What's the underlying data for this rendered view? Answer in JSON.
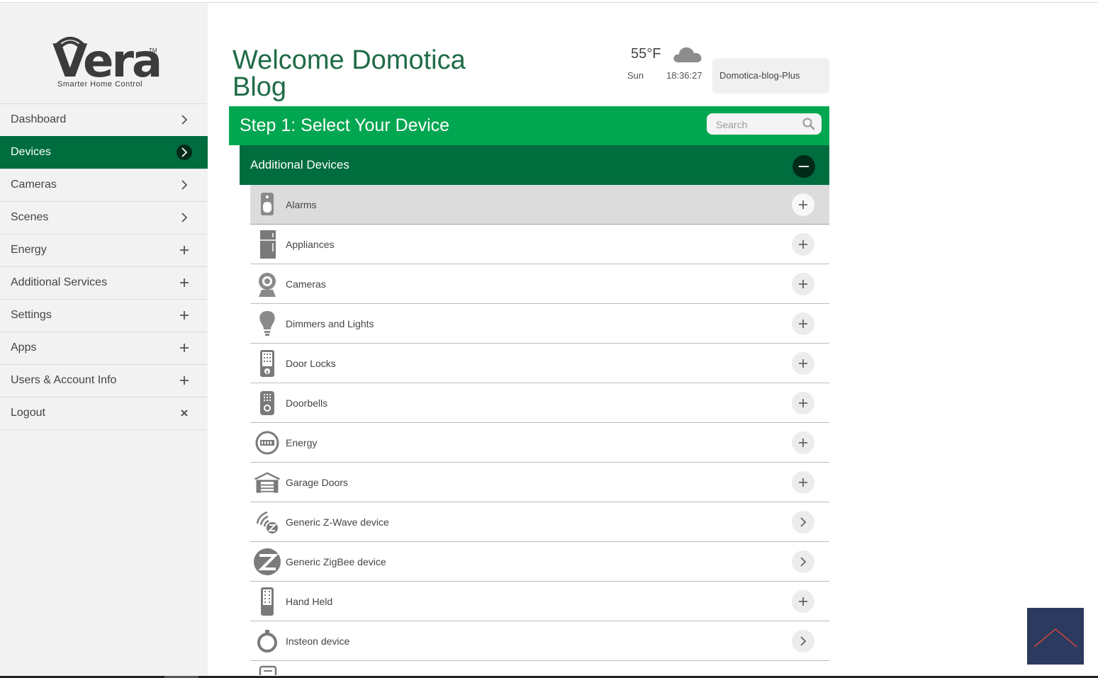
{
  "brand": {
    "logo_text": "Vera",
    "logo_tm": "TM",
    "tagline": "Smarter Home Control"
  },
  "sidebar": {
    "items": [
      {
        "label": "Dashboard",
        "icon": "chevron-right-icon",
        "active": false
      },
      {
        "label": "Devices",
        "icon": "chevron-right-icon",
        "active": true
      },
      {
        "label": "Cameras",
        "icon": "chevron-right-icon",
        "active": false
      },
      {
        "label": "Scenes",
        "icon": "chevron-right-icon",
        "active": false
      },
      {
        "label": "Energy",
        "icon": "plus-icon",
        "active": false
      },
      {
        "label": "Additional Services",
        "icon": "plus-icon",
        "active": false
      },
      {
        "label": "Settings",
        "icon": "plus-icon",
        "active": false
      },
      {
        "label": "Apps",
        "icon": "plus-icon",
        "active": false
      },
      {
        "label": "Users & Account Info",
        "icon": "plus-icon",
        "active": false
      },
      {
        "label": "Logout",
        "icon": "close-icon",
        "active": false
      }
    ]
  },
  "header": {
    "welcome": "Welcome Domotica Blog",
    "weather": {
      "temperature": "55°F",
      "icon": "cloud-icon",
      "day": "Sun",
      "time": "18:36:27"
    },
    "account_name": "Domotica-blog-Plus"
  },
  "step": {
    "title": "Step 1: Select Your Device",
    "search_placeholder": "Search"
  },
  "category": {
    "title": "Additional Devices"
  },
  "devices": [
    {
      "label": "Alarms",
      "icon": "alarm-sensor-icon",
      "action": "plus-icon",
      "highlight": true
    },
    {
      "label": "Appliances",
      "icon": "appliance-icon",
      "action": "plus-icon"
    },
    {
      "label": "Cameras",
      "icon": "camera-icon",
      "action": "plus-icon"
    },
    {
      "label": "Dimmers and Lights",
      "icon": "light-bulb-icon",
      "action": "plus-icon"
    },
    {
      "label": "Door Locks",
      "icon": "door-lock-icon",
      "action": "plus-icon"
    },
    {
      "label": "Doorbells",
      "icon": "doorbell-icon",
      "action": "plus-icon"
    },
    {
      "label": "Energy",
      "icon": "energy-meter-icon",
      "action": "plus-icon"
    },
    {
      "label": "Garage Doors",
      "icon": "garage-door-icon",
      "action": "plus-icon"
    },
    {
      "label": "Generic Z-Wave device",
      "icon": "zwave-icon",
      "action": "chevron-right-icon"
    },
    {
      "label": "Generic ZigBee device",
      "icon": "zigbee-icon",
      "action": "chevron-right-icon"
    },
    {
      "label": "Hand Held",
      "icon": "remote-control-icon",
      "action": "plus-icon"
    },
    {
      "label": "Insteon device",
      "icon": "insteon-icon",
      "action": "chevron-right-icon"
    }
  ],
  "colors": {
    "accent_green": "#00a650",
    "dark_green": "#006d3f",
    "darkest_green": "#002b18",
    "title_green": "#1f6b46",
    "sidebar_bg": "#f2f2f2",
    "back_to_top_bg": "#2b3a5e",
    "back_to_top_arrow": "#d2453c"
  }
}
